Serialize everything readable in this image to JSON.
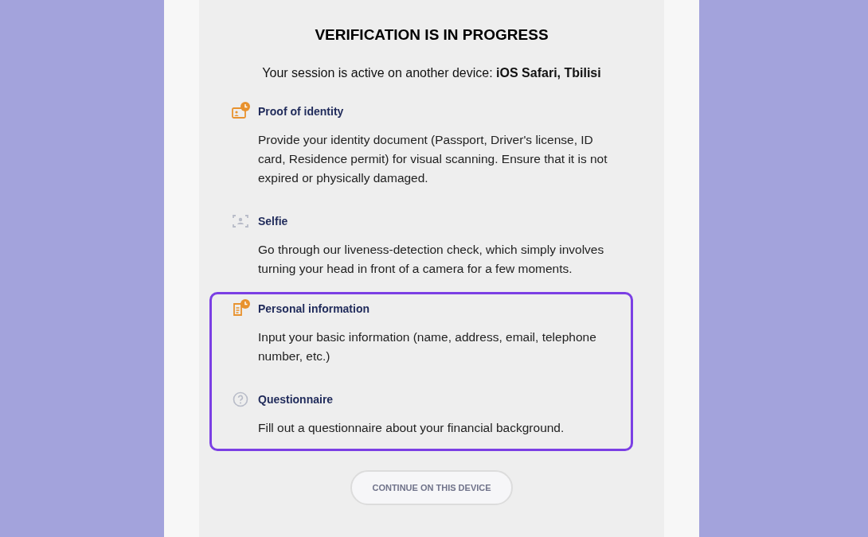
{
  "title": "VERIFICATION IS IN PROGRESS",
  "session": "Your session is active on another device: **iOS Safari, Tbilisi**",
  "step_groups": [
    {
      "highlighted": false,
      "steps": [
        {
          "kind": "id-card",
          "pending": true,
          "title": "Proof of identity",
          "description": "Provide your identity document (Passport, Driver's license, ID card, Residence permit) for visual scanning. Ensure that it is not expired or physically damaged."
        },
        {
          "kind": "selfie",
          "pending": false,
          "title": "Selfie",
          "description": "Go through our liveness-detection check, which simply involves turning your head in front of a camera for a few moments."
        }
      ]
    },
    {
      "highlighted": true,
      "steps": [
        {
          "kind": "document",
          "pending": true,
          "title": "Personal information",
          "description": "Input your basic information (name, address, email, telephone number, etc.)"
        },
        {
          "kind": "question",
          "pending": false,
          "title": "Questionnaire",
          "description": "Fill out a questionnaire about your financial background."
        }
      ]
    }
  ],
  "button": "CONTINUE ON THIS DEVICE"
}
